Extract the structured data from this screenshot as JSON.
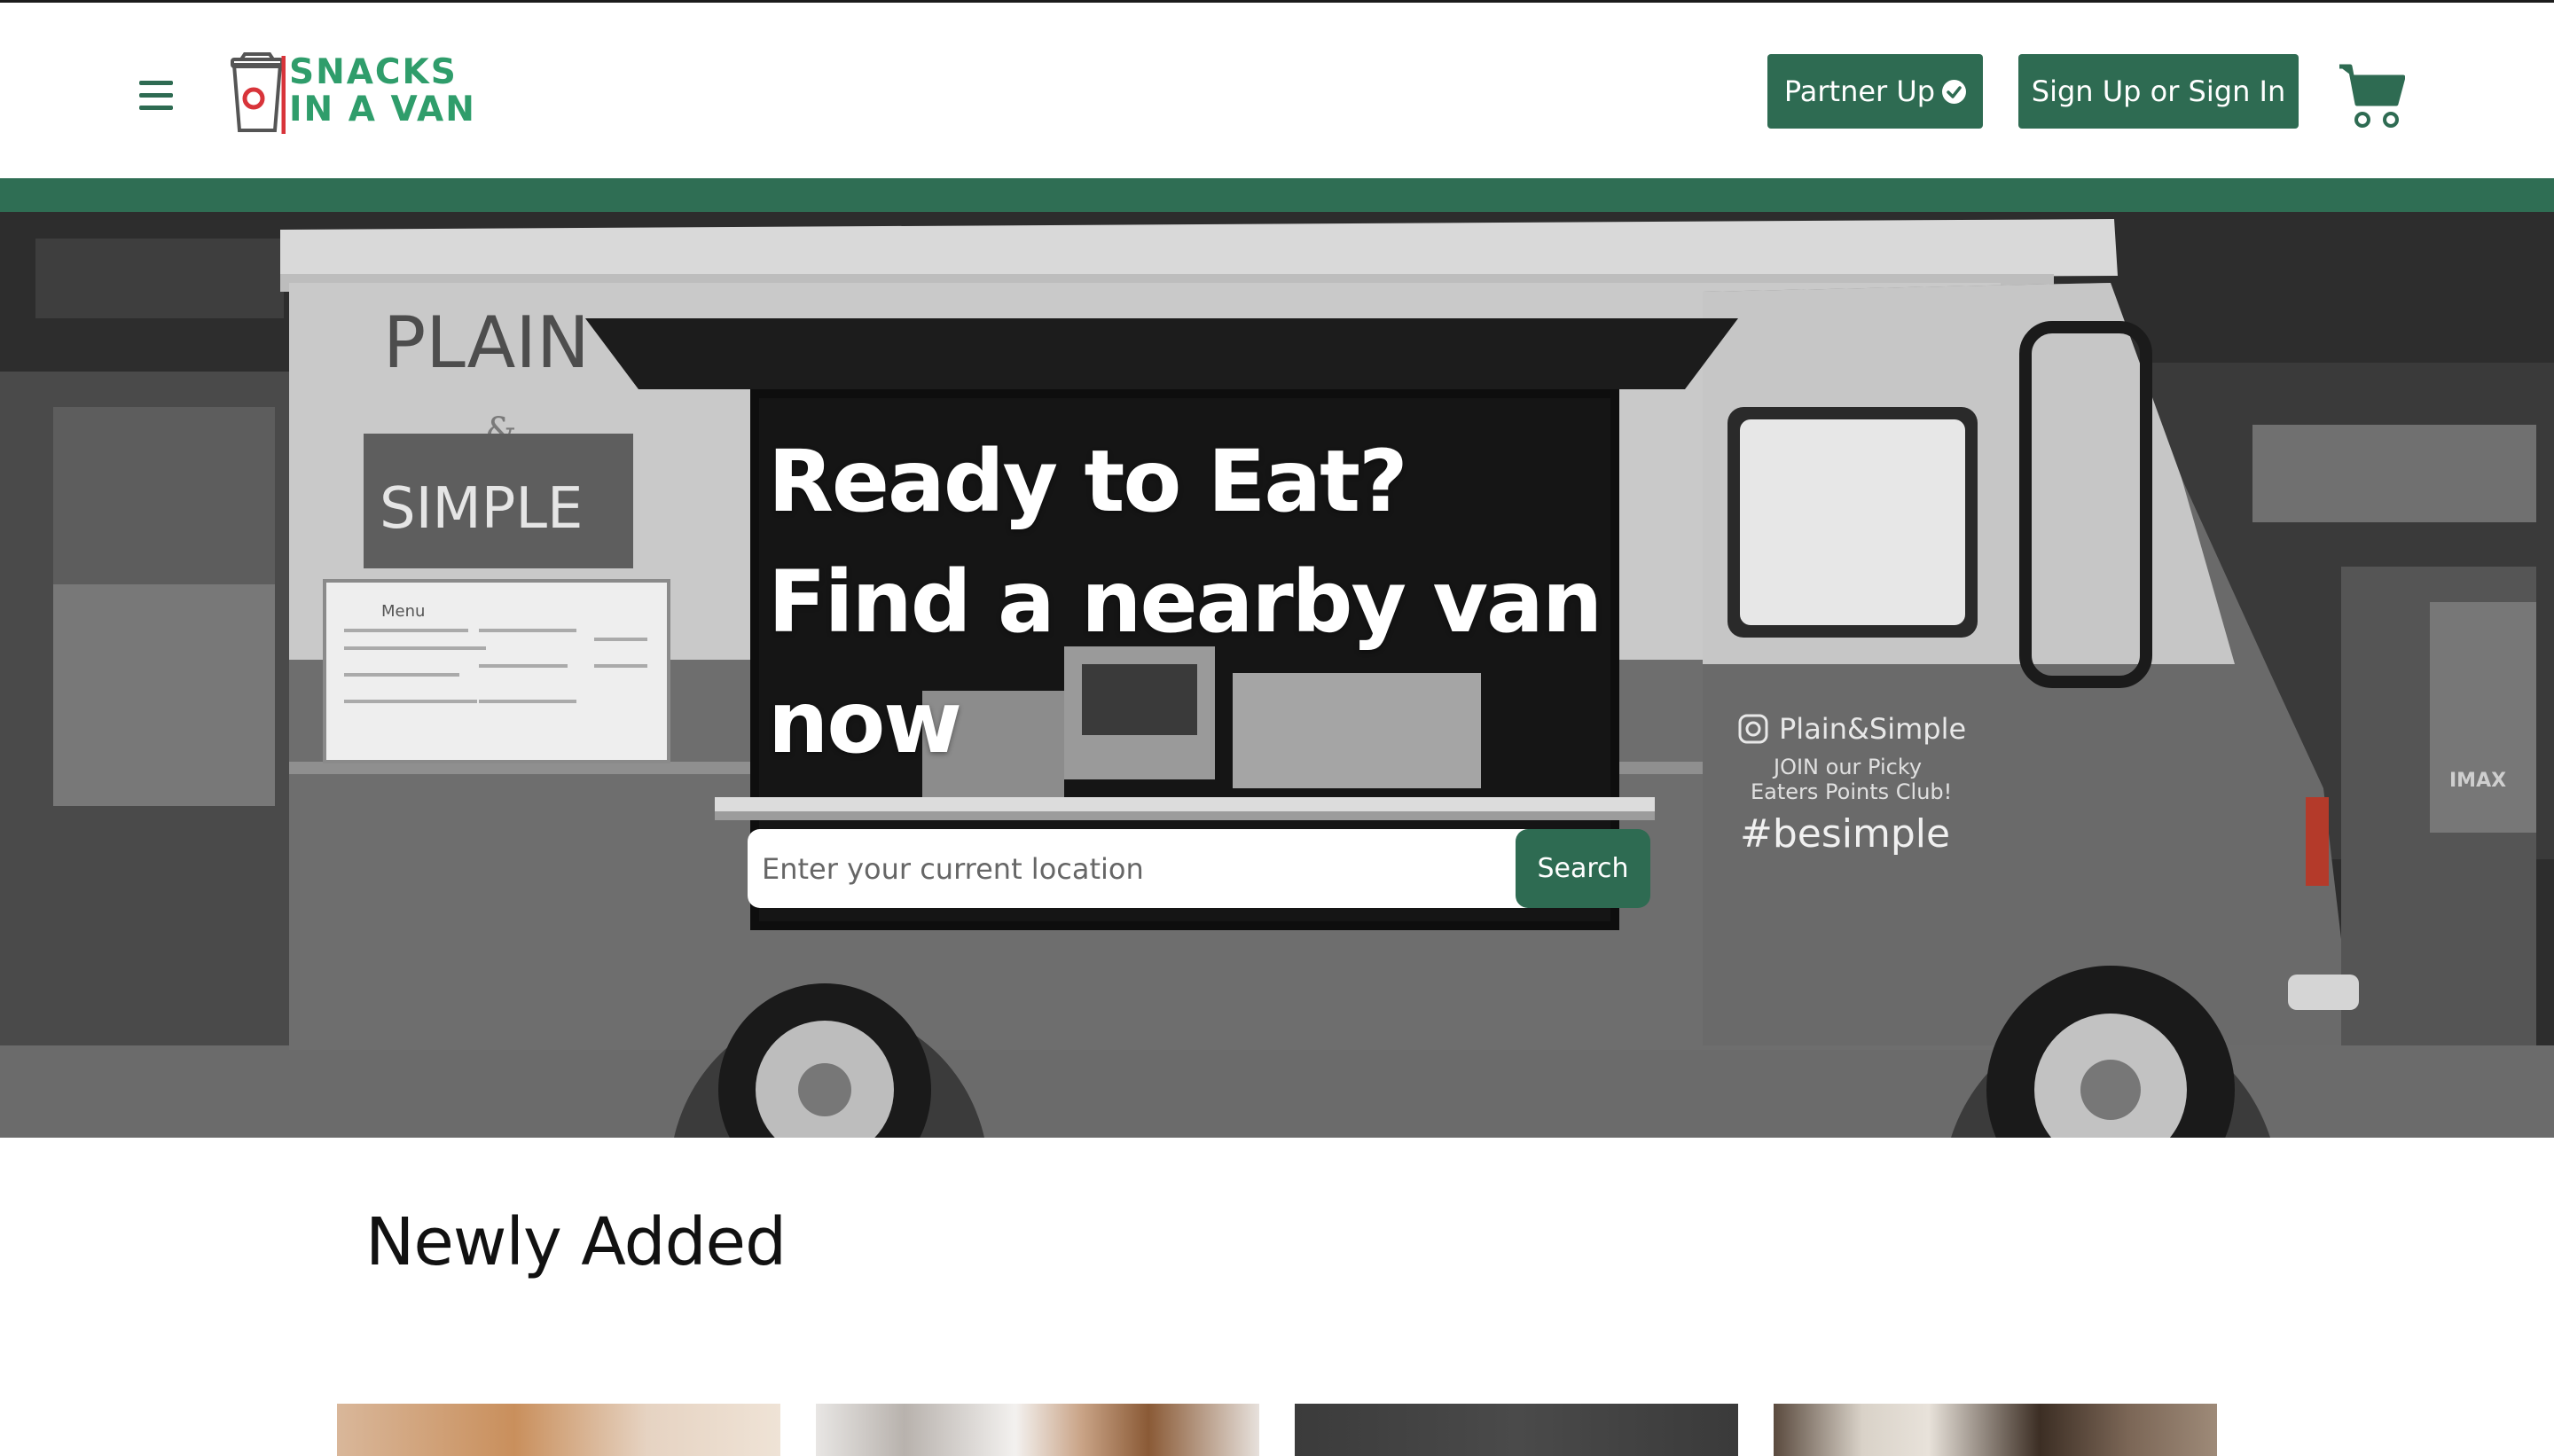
{
  "header": {
    "logo_line1": "SNACKS",
    "logo_line2": "IN A VAN",
    "partner_label": "Partner Up",
    "signin_label": "Sign Up or Sign In"
  },
  "hero": {
    "heading_line1": "Ready to Eat?",
    "heading_line2": "Find a nearby van",
    "heading_line3": "now",
    "search_placeholder": "Enter your current location",
    "search_button": "Search",
    "van": {
      "brand_top": "PLAIN",
      "brand_amp": "&",
      "brand_bottom": "SIMPLE",
      "menu_title": "Menu",
      "instagram_handle": "Plain&Simple",
      "club_line1": "JOIN our Picky",
      "club_line2": "Eaters Points Club!",
      "hashtag": "#besimple",
      "wall_sign": "IMAX"
    }
  },
  "newly_added": {
    "title": "Newly Added"
  },
  "colors": {
    "brand_green": "#2e6b52",
    "logo_green": "#2f9d6b",
    "logo_red": "#d8343a"
  }
}
